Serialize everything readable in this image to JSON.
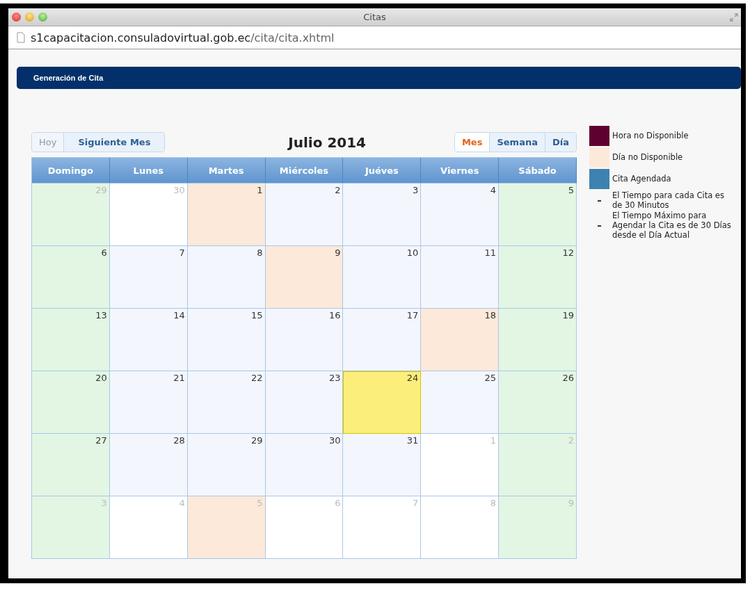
{
  "window": {
    "title": "Citas"
  },
  "address_bar": {
    "host": "s1capacitacion.consuladovirtual.gob.ec",
    "path": "/cita/cita.xhtml"
  },
  "header": {
    "title": "Generación de Cita"
  },
  "toolbar": {
    "nav_buttons": [
      {
        "label": "Hoy",
        "disabled": true
      },
      {
        "label": "Siguiente Mes",
        "disabled": false
      }
    ],
    "month_title": "Julio 2014",
    "views": [
      {
        "label": "Mes",
        "selected": true
      },
      {
        "label": "Semana",
        "selected": false
      },
      {
        "label": "Día",
        "selected": false
      }
    ]
  },
  "calendar": {
    "weekdays": [
      "Domingo",
      "Lunes",
      "Martes",
      "Miércoles",
      "Juéves",
      "Viernes",
      "Sábado"
    ],
    "weeks": [
      [
        {
          "day": "29",
          "kind": "weekend",
          "other_month": true
        },
        {
          "day": "30",
          "kind": "blank",
          "other_month": true
        },
        {
          "day": "1",
          "kind": "unavailable",
          "other_month": false
        },
        {
          "day": "2",
          "kind": "weekday",
          "other_month": false
        },
        {
          "day": "3",
          "kind": "weekday",
          "other_month": false
        },
        {
          "day": "4",
          "kind": "weekday",
          "other_month": false
        },
        {
          "day": "5",
          "kind": "weekend",
          "other_month": false
        }
      ],
      [
        {
          "day": "6",
          "kind": "weekend",
          "other_month": false
        },
        {
          "day": "7",
          "kind": "weekday",
          "other_month": false
        },
        {
          "day": "8",
          "kind": "weekday",
          "other_month": false
        },
        {
          "day": "9",
          "kind": "unavailable",
          "other_month": false
        },
        {
          "day": "10",
          "kind": "weekday",
          "other_month": false
        },
        {
          "day": "11",
          "kind": "weekday",
          "other_month": false
        },
        {
          "day": "12",
          "kind": "weekend",
          "other_month": false
        }
      ],
      [
        {
          "day": "13",
          "kind": "weekend",
          "other_month": false
        },
        {
          "day": "14",
          "kind": "weekday",
          "other_month": false
        },
        {
          "day": "15",
          "kind": "weekday",
          "other_month": false
        },
        {
          "day": "16",
          "kind": "weekday",
          "other_month": false
        },
        {
          "day": "17",
          "kind": "weekday",
          "other_month": false
        },
        {
          "day": "18",
          "kind": "unavailable",
          "other_month": false
        },
        {
          "day": "19",
          "kind": "weekend",
          "other_month": false
        }
      ],
      [
        {
          "day": "20",
          "kind": "weekend",
          "other_month": false
        },
        {
          "day": "21",
          "kind": "weekday",
          "other_month": false
        },
        {
          "day": "22",
          "kind": "weekday",
          "other_month": false
        },
        {
          "day": "23",
          "kind": "weekday",
          "other_month": false
        },
        {
          "day": "24",
          "kind": "today",
          "other_month": false
        },
        {
          "day": "25",
          "kind": "weekday",
          "other_month": false
        },
        {
          "day": "26",
          "kind": "weekend",
          "other_month": false
        }
      ],
      [
        {
          "day": "27",
          "kind": "weekend",
          "other_month": false
        },
        {
          "day": "28",
          "kind": "weekday",
          "other_month": false
        },
        {
          "day": "29",
          "kind": "weekday",
          "other_month": false
        },
        {
          "day": "30",
          "kind": "weekday",
          "other_month": false
        },
        {
          "day": "31",
          "kind": "weekday",
          "other_month": false
        },
        {
          "day": "1",
          "kind": "blank",
          "other_month": true
        },
        {
          "day": "2",
          "kind": "weekend",
          "other_month": true
        }
      ],
      [
        {
          "day": "3",
          "kind": "weekend",
          "other_month": true
        },
        {
          "day": "4",
          "kind": "blank",
          "other_month": true
        },
        {
          "day": "5",
          "kind": "unavailable",
          "other_month": true
        },
        {
          "day": "6",
          "kind": "blank",
          "other_month": true
        },
        {
          "day": "7",
          "kind": "blank",
          "other_month": true
        },
        {
          "day": "8",
          "kind": "blank",
          "other_month": true
        },
        {
          "day": "9",
          "kind": "weekend",
          "other_month": true
        }
      ]
    ]
  },
  "legend": [
    {
      "kind": "swatch",
      "color": "#5e0030",
      "label": "Hora no Disponible"
    },
    {
      "kind": "swatch",
      "color": "#fde9d9",
      "label": "Día no Disponible"
    },
    {
      "kind": "swatch",
      "color": "#3d82b0",
      "label": "Cita Agendada"
    },
    {
      "kind": "note",
      "label": "El Tiempo para cada Cita es de 30 Minutos"
    },
    {
      "kind": "note",
      "label": "El Tiempo Máximo para Agendar la Cita es de 30 Días desde el Día Actual"
    }
  ]
}
